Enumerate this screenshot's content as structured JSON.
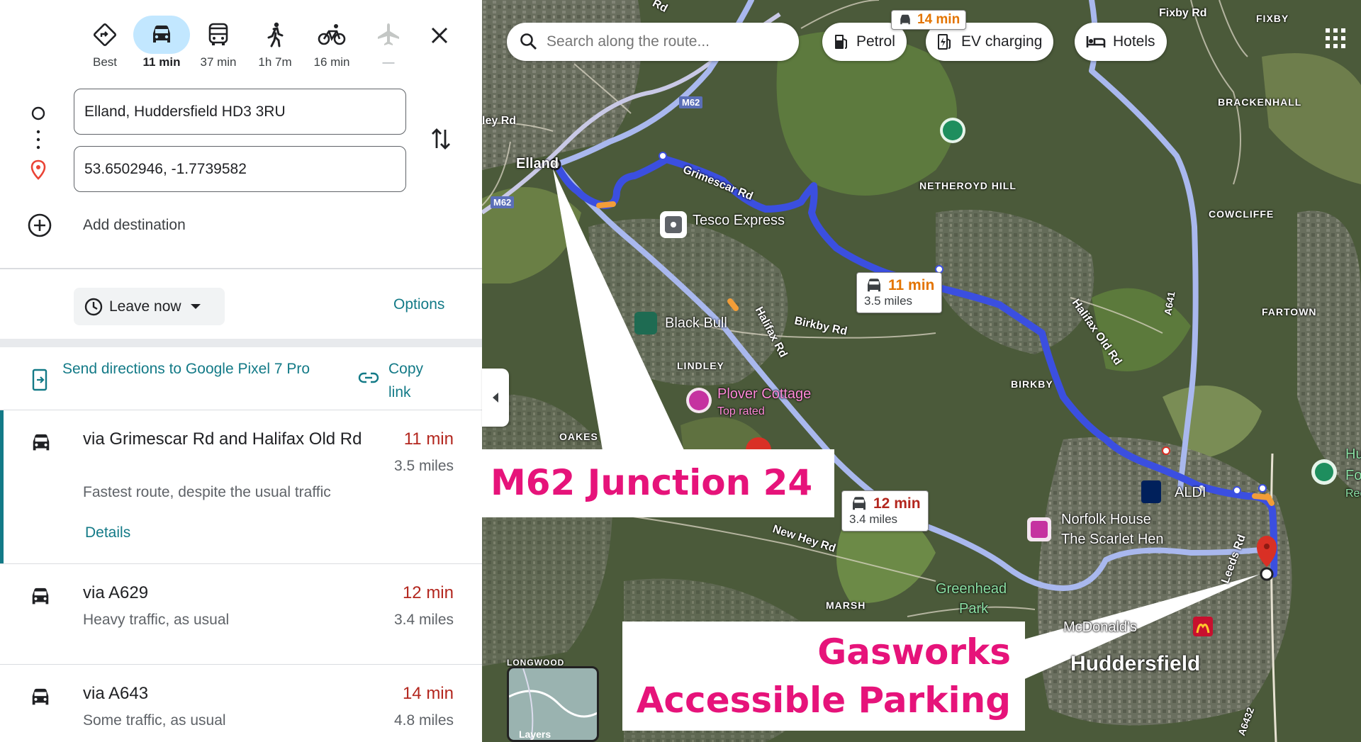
{
  "modes": [
    {
      "key": "best",
      "label": "Best",
      "icon": "diamond-directions-icon",
      "active": false
    },
    {
      "key": "drive",
      "label": "11 min",
      "icon": "car-icon",
      "active": true
    },
    {
      "key": "transit",
      "label": "37 min",
      "icon": "bus-icon",
      "active": false
    },
    {
      "key": "walk",
      "label": "1h 7m",
      "icon": "walk-icon",
      "active": false
    },
    {
      "key": "cycle",
      "label": "16 min",
      "icon": "bicycle-icon",
      "active": false
    },
    {
      "key": "flight",
      "label": "—",
      "icon": "airplane-icon",
      "active": false
    }
  ],
  "origin": {
    "value": "Elland, Huddersfield HD3 3RU"
  },
  "destination": {
    "value": "53.6502946, -1.7739582"
  },
  "add_destination": "Add destination",
  "leave_now": "Leave now",
  "options": "Options",
  "send_directions": "Send directions to Google Pixel 7 Pro",
  "copy_link": "Copy link",
  "routes": [
    {
      "name": "via Grimescar Rd and Halifax Old Rd",
      "time": "11 min",
      "distance": "3.5 miles",
      "desc": "Fastest route, despite the usual traffic",
      "details": "Details"
    },
    {
      "name": "via A629",
      "time": "12 min",
      "distance": "3.4 miles",
      "desc": "Heavy traffic, as usual"
    },
    {
      "name": "via A643",
      "time": "14 min",
      "distance": "4.8 miles",
      "desc": "Some traffic, as usual"
    }
  ],
  "map": {
    "search_placeholder": "Search along the route...",
    "chips": [
      "Petrol",
      "EV charging",
      "Hotels"
    ],
    "callouts": [
      {
        "time": "11 min",
        "distance": "3.5 miles"
      },
      {
        "time": "12 min",
        "distance": "3.4 miles"
      },
      {
        "time": "14 min"
      }
    ],
    "places": {
      "elland": "Elland",
      "tesco": "Tesco Express",
      "black_bull": "Black Bull",
      "plover": "Plover Cottage",
      "plover_sub": "Top rated",
      "aldi": "ALDI",
      "norfolk": "Norfolk House",
      "scarlet": "The Scarlet Hen",
      "greenhead": "Greenhead",
      "greenhead2": "Park",
      "mcdonalds": "McDonald's",
      "huddersfield": "Huddersfield",
      "hu_partial": "Hu",
      "fo_partial": "Fo",
      "re_partial": "Rec"
    },
    "areas": {
      "fixby": "FIXBY",
      "brackenhall": "BRACKENHALL",
      "netheroyd": "NETHEROYD HILL",
      "cowcliffe": "COWCLIFFE",
      "fartown": "FARTOWN",
      "lindley": "LINDLEY",
      "birkby": "BIRKBY",
      "oakes": "OAKES",
      "marsh": "MARSH",
      "longwood": "LONGWOOD"
    },
    "roads": {
      "fixby_rd": "Fixby Rd",
      "grimescar": "Grimescar Rd",
      "halifax_old": "Halifax Old Rd",
      "halifax_rd": "Halifax Rd",
      "birkby_rd": "Birkby Rd",
      "new_hey": "New Hey Rd",
      "leeds_rd": "Leeds Rd",
      "a641": "A641",
      "m62a": "M62",
      "m62b": "M62",
      "a6432": "A6432",
      "ley_rd": "ley Rd",
      "rd_top": "Rd"
    },
    "layers": "Layers",
    "annotations": {
      "junction": "M62 Junction 24",
      "gasworks_1": "Gasworks",
      "gasworks_2": "Accessible Parking"
    }
  },
  "colors": {
    "route_primary": "#3b4fe0",
    "route_alt": "#a9b8ee",
    "annotation": "#e6137a",
    "accent_teal": "#137a87",
    "traffic_red": "#b3261e"
  }
}
